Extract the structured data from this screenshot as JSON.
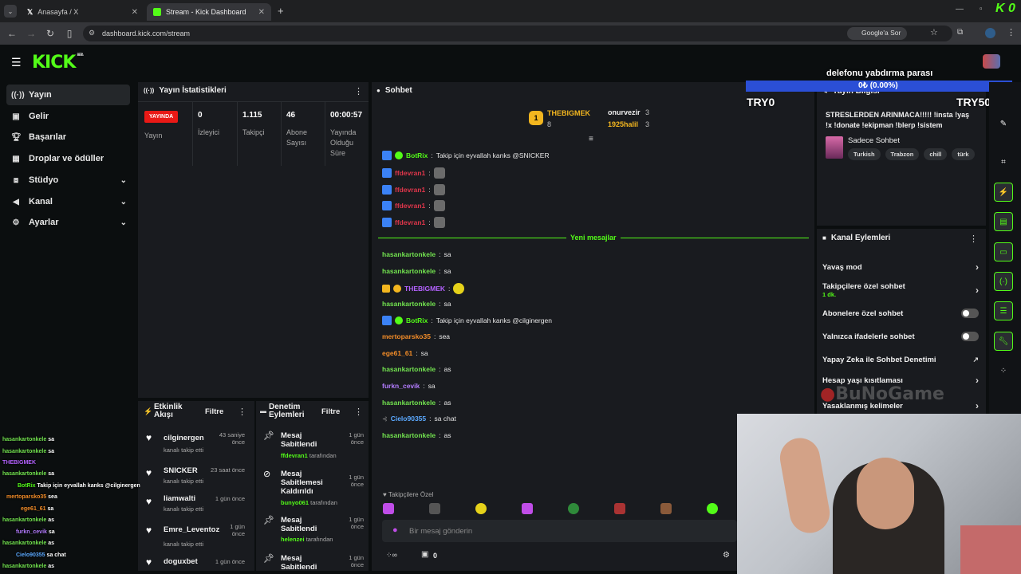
{
  "browser": {
    "tabs": [
      {
        "label": "Anasayfa / X"
      },
      {
        "label": "Stream - Kick Dashboard"
      }
    ],
    "url": "dashboard.kick.com/stream",
    "google_btn": "Google'a Sor",
    "corner_logo": "K 0"
  },
  "logo": {
    "text": "KICK",
    "sup": "BETA"
  },
  "sidebar": {
    "items": [
      {
        "label": "Yayın",
        "icon": "broadcast-icon"
      },
      {
        "label": "Gelir",
        "icon": "money-icon"
      },
      {
        "label": "Başarılar",
        "icon": "trophy-icon"
      },
      {
        "label": "Droplar ve ödüller",
        "icon": "gift-icon"
      },
      {
        "label": "Stüdyo",
        "icon": "studio-icon"
      },
      {
        "label": "Kanal",
        "icon": "megaphone-icon"
      },
      {
        "label": "Ayarlar",
        "icon": "gear-icon"
      }
    ]
  },
  "stats": {
    "title": "Yayın İstatistikleri",
    "live": "YAYINDA",
    "live_label": "Yayın",
    "viewers": {
      "value": "0",
      "label": "İzleyici"
    },
    "followers": {
      "value": "1.115",
      "label": "Takipçi"
    },
    "subs": {
      "value": "46",
      "label": "Abone Sayısı"
    },
    "uptime": {
      "value": "00:00:57",
      "label": "Yayında Olduğu Süre"
    }
  },
  "chat": {
    "title": "Sohbet",
    "gifters": [
      {
        "name": "THEBIGMEK",
        "count": "8",
        "rank": "1"
      },
      {
        "name": "onurvezir",
        "count": "3"
      },
      {
        "name": "1925halil",
        "count": "3"
      }
    ],
    "new_messages": "Yeni mesajlar",
    "messages": [
      {
        "user": "BotRix",
        "text": "Takip için eyvallah kanks @SNICKER",
        "color": "#53fc18"
      },
      {
        "user": "ffdevran1",
        "text": "",
        "color": "#e0364b"
      },
      {
        "user": "ffdevran1",
        "text": "",
        "color": "#e0364b"
      },
      {
        "user": "ffdevran1",
        "text": "",
        "color": "#e0364b"
      },
      {
        "user": "ffdevran1",
        "text": "",
        "color": "#e0364b"
      },
      {
        "user": "hasankartonkele",
        "text": "sa",
        "color": "#72e24f"
      },
      {
        "user": "hasankartonkele",
        "text": "sa",
        "color": "#72e24f"
      },
      {
        "user": "THEBIGMEK",
        "text": "",
        "color": "#b462ff"
      },
      {
        "user": "hasankartonkele",
        "text": "sa",
        "color": "#72e24f"
      },
      {
        "user": "BotRix",
        "text": "Takip için eyvallah kanks @cilginergen",
        "color": "#53fc18"
      },
      {
        "user": "mertoparsko35",
        "text": "sea",
        "color": "#f28c28"
      },
      {
        "user": "ege61_61",
        "text": "sa",
        "color": "#f28c28"
      },
      {
        "user": "hasankartonkele",
        "text": "as",
        "color": "#72e24f"
      },
      {
        "user": "furkn_cevik",
        "text": "sa",
        "color": "#b47cff"
      },
      {
        "user": "hasankartonkele",
        "text": "as",
        "color": "#72e24f"
      },
      {
        "user": "Cielo90355",
        "text": "sa chat",
        "color": "#5ba9ff"
      },
      {
        "user": "hasankartonkele",
        "text": "as",
        "color": "#72e24f"
      }
    ],
    "followers_only": "Takipçilere Özel",
    "placeholder": "Bir mesaj gönderin",
    "points": "0"
  },
  "activity": {
    "title": "Etkinlik Akışı",
    "filter": "Filtre",
    "rows": [
      {
        "name": "cilginergen",
        "sub": "kanalı takip etti",
        "time": "43 saniye önce"
      },
      {
        "name": "SNICKER",
        "sub": "kanalı takip etti",
        "time": "23 saat önce"
      },
      {
        "name": "liamwalti",
        "sub": "kanalı takip etti",
        "time": "1 gün önce"
      },
      {
        "name": "Emre_Leventoz",
        "sub": "kanalı takip etti",
        "time": "1 gün önce"
      },
      {
        "name": "doguxbet",
        "sub": "",
        "time": "1 gün önce"
      }
    ]
  },
  "moderation": {
    "title": "Denetim Eylemleri",
    "filter": "Filtre",
    "rows": [
      {
        "title": "Mesaj Sabitlendi",
        "by": "ffdevran1",
        "by_suffix": "tarafından",
        "time": "1 gün önce"
      },
      {
        "title": "Mesaj Sabitlemesi Kaldırıldı",
        "by": "bunyo061",
        "by_suffix": "tarafından",
        "time": "1 gün önce"
      },
      {
        "title": "Mesaj Sabitlendi",
        "by": "helenzei",
        "by_suffix": "tarafından",
        "time": "1 gün önce"
      },
      {
        "title": "Mesaj Sabitlendi",
        "by": "",
        "by_suffix": "",
        "time": "1 gün önce"
      }
    ]
  },
  "stream_info": {
    "title": "Yayın Bilgisi",
    "text": "STRESLERDEN ARINMACA!!!!! !insta !yaş !x !donate !ekipman !blerp !sistem",
    "category": "Sadece Sohbet",
    "tags": [
      "Turkish",
      "Trabzon",
      "chill",
      "türk"
    ]
  },
  "goal": {
    "title": "delefonu yabdırma parası",
    "progress_label": "0₺ (0.00%)",
    "progress": 0.0,
    "min": "TRY0",
    "max": "TRY5000"
  },
  "channel_actions": {
    "title": "Kanal Eylemleri",
    "items": [
      {
        "label": "Yavaş mod",
        "type": "arrow"
      },
      {
        "label": "Takipçilere özel sohbet",
        "sub": "1 dk.",
        "type": "arrow"
      },
      {
        "label": "Abonelere özel sohbet",
        "type": "toggle"
      },
      {
        "label": "Yalnızca ifadelerle sohbet",
        "type": "toggle"
      },
      {
        "label": "Yapay Zeka ile Sohbet Denetimi",
        "type": "external"
      },
      {
        "label": "Hesap yaşı kısıtlaması",
        "type": "arrow"
      },
      {
        "label": "Yasaklanmış kelimeler",
        "type": "arrow"
      }
    ]
  },
  "watermark": "BuNoGame",
  "overlay_chat": [
    {
      "user": "hasankartonkele",
      "text": "sa"
    },
    {
      "user": "hasankartonkele",
      "text": "sa"
    },
    {
      "user": "THEBIGMEK",
      "text": ""
    },
    {
      "user": "hasankartonkele",
      "text": "sa"
    },
    {
      "user": "BotRix",
      "text": "Takip için eyvallah kanks @cilginergen"
    },
    {
      "user": "mertoparsko35",
      "text": "sea"
    },
    {
      "user": "ege61_61",
      "text": "sa"
    },
    {
      "user": "hasankartonkele",
      "text": "as"
    },
    {
      "user": "furkn_cevik",
      "text": "sa"
    },
    {
      "user": "hasankartonkele",
      "text": "as"
    },
    {
      "user": "Cielo90355",
      "text": "sa chat"
    },
    {
      "user": "hasankartonkele",
      "text": "as"
    }
  ]
}
